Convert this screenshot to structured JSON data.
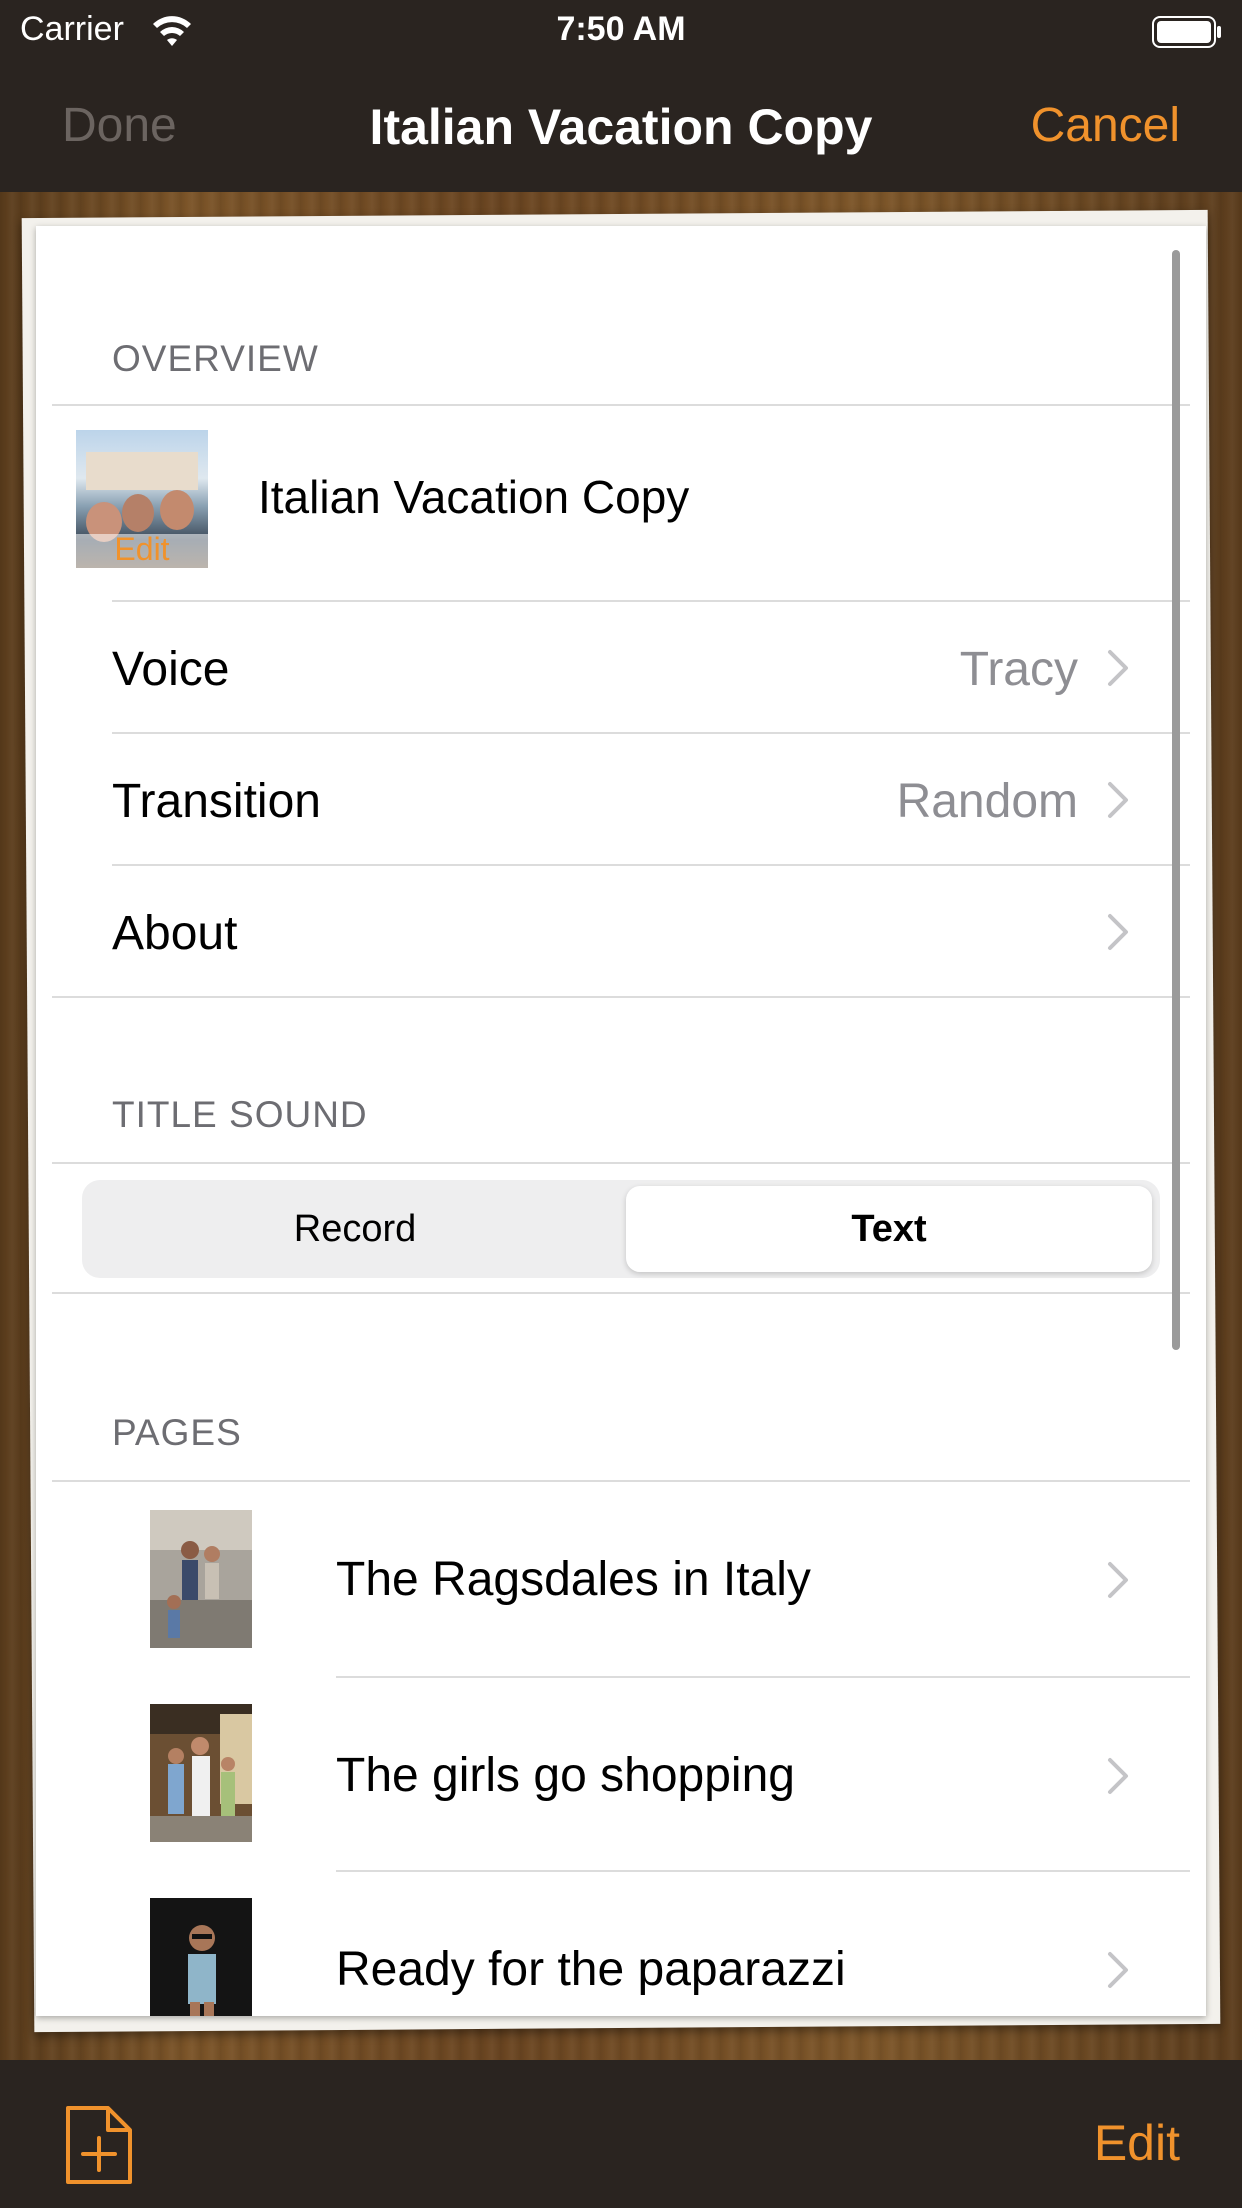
{
  "status_bar": {
    "carrier": "Carrier",
    "time": "7:50 AM",
    "icons": [
      "wifi-icon",
      "battery-icon"
    ]
  },
  "nav": {
    "done": "Done",
    "title": "Italian Vacation Copy",
    "cancel": "Cancel"
  },
  "overview": {
    "header": "OVERVIEW",
    "book_title": "Italian Vacation Copy",
    "thumb_edit": "Edit",
    "rows": [
      {
        "label": "Voice",
        "value": "Tracy"
      },
      {
        "label": "Transition",
        "value": "Random"
      },
      {
        "label": "About",
        "value": ""
      }
    ]
  },
  "title_sound": {
    "header": "TITLE SOUND",
    "options": [
      "Record",
      "Text"
    ],
    "selected": "Text"
  },
  "pages": {
    "header": "PAGES",
    "items": [
      {
        "label": "The Ragsdales in Italy"
      },
      {
        "label": "The girls go shopping"
      },
      {
        "label": "Ready for the paparazzi"
      }
    ]
  },
  "toolbar": {
    "add_icon": "add-page-icon",
    "edit": "Edit"
  },
  "colors": {
    "accent": "#f0922c",
    "bar_bg": "#2a2420",
    "secondary_text": "#8e8e93"
  }
}
